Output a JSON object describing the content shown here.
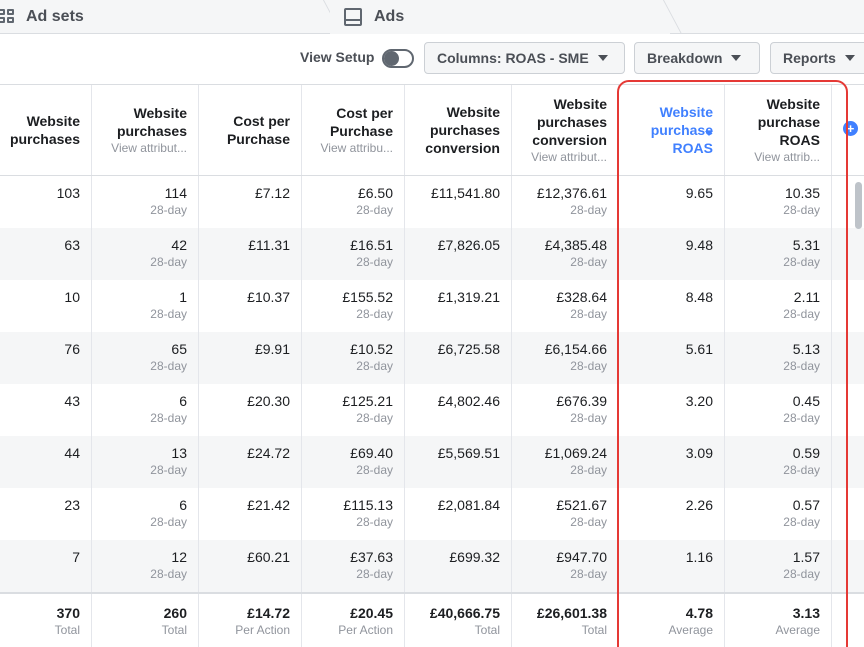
{
  "tabs": {
    "adsets": "Ad sets",
    "ads": "Ads"
  },
  "toolbar": {
    "view_setup": "View Setup",
    "columns": "Columns: ROAS - SME",
    "breakdown": "Breakdown",
    "reports": "Reports"
  },
  "colors": {
    "accent": "#4080ff",
    "highlight": "#e53935",
    "alt_row": "#f5f6f7"
  },
  "columns": [
    {
      "title": "Website purchases",
      "sub": ""
    },
    {
      "title": "Website purchases",
      "sub": "View attribut..."
    },
    {
      "title": "Cost per Purchase",
      "sub": ""
    },
    {
      "title": "Cost per Purchase",
      "sub": "View attribu..."
    },
    {
      "title": "Website purchases conversion",
      "sub": ""
    },
    {
      "title": "Website purchases conversion",
      "sub": "View attribut..."
    },
    {
      "title": "Website purchase ROAS",
      "sub": "",
      "shown": "Website\npurchase\nROAS",
      "sorted": true
    },
    {
      "title": "Website purchase ROAS",
      "sub": "View attrib...",
      "shown": "Website\npurchase\nROAS"
    }
  ],
  "rows": [
    {
      "cells": [
        [
          "103",
          ""
        ],
        [
          "114",
          "28-day"
        ],
        [
          "£7.12",
          ""
        ],
        [
          "£6.50",
          "28-day"
        ],
        [
          "£11,541.80",
          ""
        ],
        [
          "£12,376.61",
          "28-day"
        ],
        [
          "9.65",
          ""
        ],
        [
          "10.35",
          "28-day"
        ]
      ]
    },
    {
      "cells": [
        [
          "63",
          ""
        ],
        [
          "42",
          "28-day"
        ],
        [
          "£11.31",
          ""
        ],
        [
          "£16.51",
          "28-day"
        ],
        [
          "£7,826.05",
          ""
        ],
        [
          "£4,385.48",
          "28-day"
        ],
        [
          "9.48",
          ""
        ],
        [
          "5.31",
          "28-day"
        ]
      ]
    },
    {
      "cells": [
        [
          "10",
          ""
        ],
        [
          "1",
          "28-day"
        ],
        [
          "£10.37",
          ""
        ],
        [
          "£155.52",
          "28-day"
        ],
        [
          "£1,319.21",
          ""
        ],
        [
          "£328.64",
          "28-day"
        ],
        [
          "8.48",
          ""
        ],
        [
          "2.11",
          "28-day"
        ]
      ]
    },
    {
      "cells": [
        [
          "76",
          ""
        ],
        [
          "65",
          "28-day"
        ],
        [
          "£9.91",
          ""
        ],
        [
          "£10.52",
          "28-day"
        ],
        [
          "£6,725.58",
          ""
        ],
        [
          "£6,154.66",
          "28-day"
        ],
        [
          "5.61",
          ""
        ],
        [
          "5.13",
          "28-day"
        ]
      ]
    },
    {
      "cells": [
        [
          "43",
          ""
        ],
        [
          "6",
          "28-day"
        ],
        [
          "£20.30",
          ""
        ],
        [
          "£125.21",
          "28-day"
        ],
        [
          "£4,802.46",
          ""
        ],
        [
          "£676.39",
          "28-day"
        ],
        [
          "3.20",
          ""
        ],
        [
          "0.45",
          "28-day"
        ]
      ]
    },
    {
      "cells": [
        [
          "44",
          ""
        ],
        [
          "13",
          "28-day"
        ],
        [
          "£24.72",
          ""
        ],
        [
          "£69.40",
          "28-day"
        ],
        [
          "£5,569.51",
          ""
        ],
        [
          "£1,069.24",
          "28-day"
        ],
        [
          "3.09",
          ""
        ],
        [
          "0.59",
          "28-day"
        ]
      ]
    },
    {
      "cells": [
        [
          "23",
          ""
        ],
        [
          "6",
          "28-day"
        ],
        [
          "£21.42",
          ""
        ],
        [
          "£115.13",
          "28-day"
        ],
        [
          "£2,081.84",
          ""
        ],
        [
          "£521.67",
          "28-day"
        ],
        [
          "2.26",
          ""
        ],
        [
          "0.57",
          "28-day"
        ]
      ]
    },
    {
      "cells": [
        [
          "7",
          ""
        ],
        [
          "12",
          "28-day"
        ],
        [
          "£60.21",
          ""
        ],
        [
          "£37.63",
          "28-day"
        ],
        [
          "£699.32",
          ""
        ],
        [
          "£947.70",
          "28-day"
        ],
        [
          "1.16",
          ""
        ],
        [
          "1.57",
          "28-day"
        ]
      ]
    }
  ],
  "totals": [
    [
      "370",
      "Total"
    ],
    [
      "260",
      "Total"
    ],
    [
      "£14.72",
      "Per Action"
    ],
    [
      "£20.45",
      "Per Action"
    ],
    [
      "£40,666.75",
      "Total"
    ],
    [
      "£26,601.38",
      "Total"
    ],
    [
      "4.78",
      "Average"
    ],
    [
      "3.13",
      "Average"
    ]
  ]
}
